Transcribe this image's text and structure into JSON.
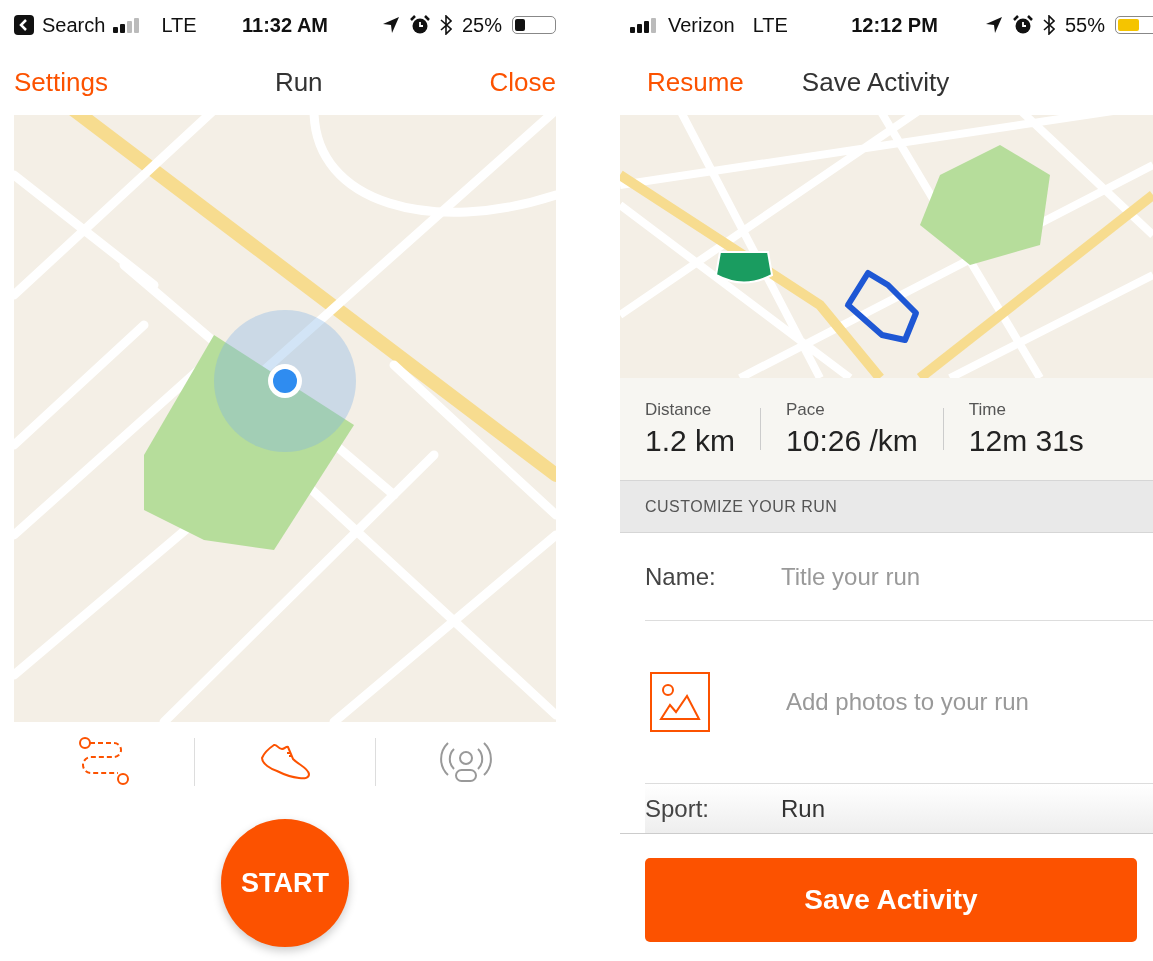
{
  "run_screen": {
    "status_bar": {
      "back_label": "Search",
      "network": "LTE",
      "time": "11:32 AM",
      "battery": "25%",
      "low_power_mode": false
    },
    "nav": {
      "left_button": "Settings",
      "title": "Run",
      "right_button": "Close"
    },
    "tools": [
      {
        "kind": "route",
        "active": true
      },
      {
        "kind": "shoe",
        "active": true
      },
      {
        "kind": "beacon",
        "active": false
      }
    ],
    "start_button": "START"
  },
  "save_screen": {
    "status_bar": {
      "carrier": "Verizon",
      "network": "LTE",
      "time": "12:12 PM",
      "battery": "55%",
      "low_power_mode": true
    },
    "nav": {
      "left_button": "Resume",
      "title": "Save Activity"
    },
    "stats": [
      {
        "label": "Distance",
        "value": "1.2 km"
      },
      {
        "label": "Pace",
        "value": "10:26 /km"
      },
      {
        "label": "Time",
        "value": "12m 31s"
      }
    ],
    "section_header": "CUSTOMIZE YOUR RUN",
    "name_field": {
      "label": "Name:",
      "placeholder": "Title your run"
    },
    "photos_prompt": "Add photos to your run",
    "sport_field": {
      "label": "Sport:",
      "value": "Run"
    },
    "save_button": "Save Activity"
  }
}
